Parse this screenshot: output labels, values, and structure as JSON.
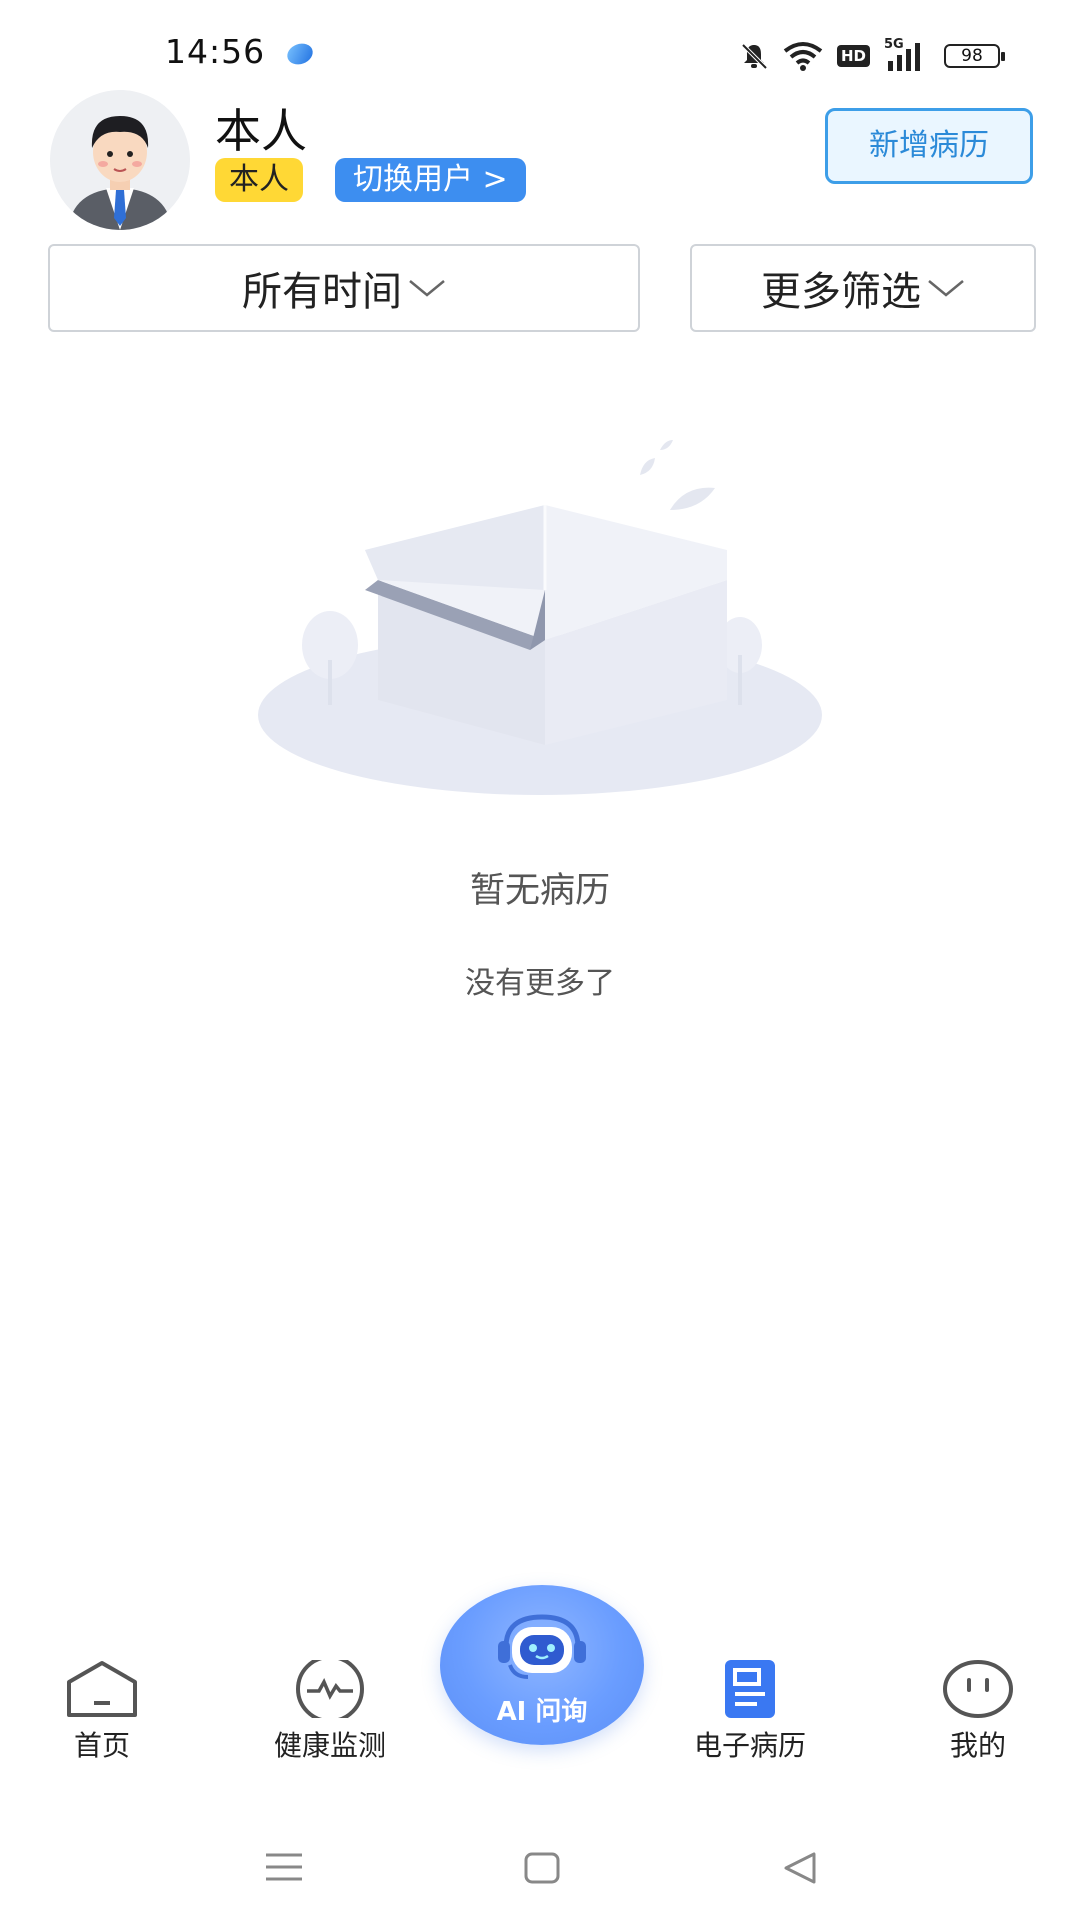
{
  "status_bar": {
    "time": "14:56",
    "hd": "HD",
    "network": "5G",
    "battery": "98"
  },
  "header": {
    "user_name": "本人",
    "tag": "本人",
    "switch_user": "切换用户 >",
    "new_record": "新增病历"
  },
  "filters": {
    "time": "所有时间",
    "more": "更多筛选"
  },
  "empty": {
    "title": "暂无病历",
    "no_more": "没有更多了"
  },
  "tabs": {
    "home": "首页",
    "health": "健康监测",
    "ai": "AI 问询",
    "records": "电子病历",
    "mine": "我的"
  },
  "colors": {
    "accent": "#3d8ef0",
    "tag_yellow": "#ffd835",
    "active_tab": "#3a78f2"
  }
}
